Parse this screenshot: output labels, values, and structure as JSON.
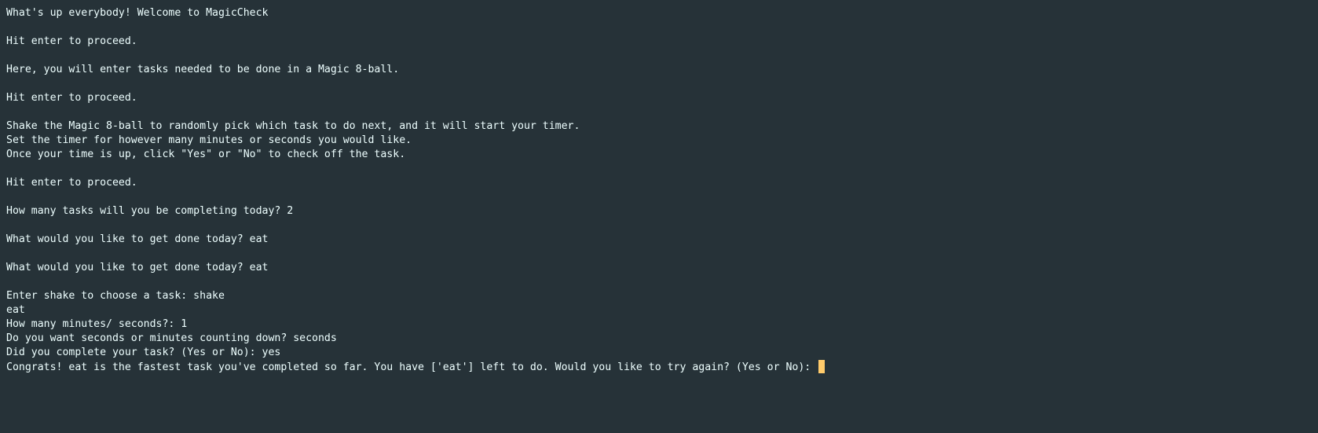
{
  "terminal": {
    "lines": [
      "What's up everybody! Welcome to MagicCheck",
      "",
      "Hit enter to proceed.",
      "",
      "Here, you will enter tasks needed to be done in a Magic 8-ball.",
      "",
      "Hit enter to proceed.",
      "",
      "Shake the Magic 8-ball to randomly pick which task to do next, and it will start your timer.",
      "Set the timer for however many minutes or seconds you would like.",
      "Once your time is up, click \"Yes\" or \"No\" to check off the task.",
      "",
      "Hit enter to proceed.",
      "",
      "How many tasks will you be completing today? 2",
      "",
      "What would you like to get done today? eat",
      "",
      "What would you like to get done today? eat",
      "",
      "Enter shake to choose a task: shake",
      "eat",
      "How many minutes/ seconds?: 1",
      "Do you want seconds or minutes counting down? seconds",
      "Did you complete your task? (Yes or No): yes"
    ],
    "prompt_line": "Congrats! eat is the fastest task you've completed so far. You have ['eat'] left to do. Would you like to try again? (Yes or No): ",
    "cursor_color": "#ffcb6b",
    "background_color": "#263238",
    "text_color": "#eeffff"
  }
}
